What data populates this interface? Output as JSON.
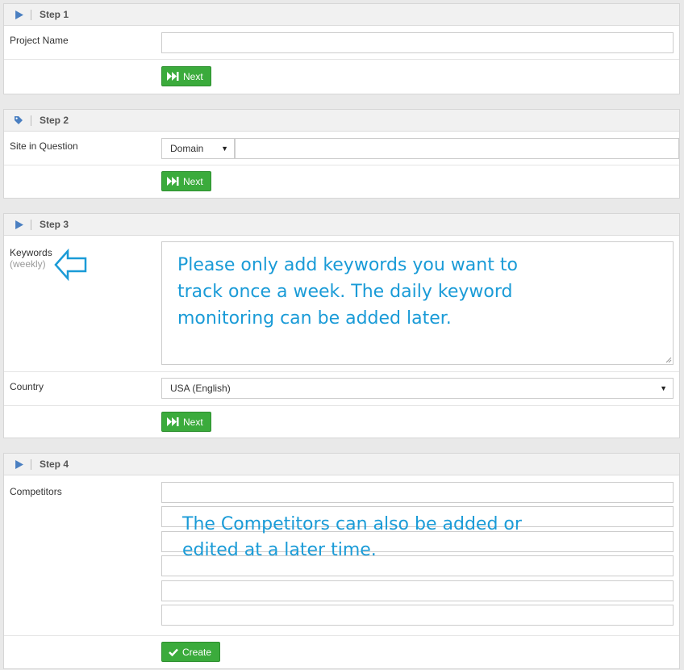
{
  "steps": [
    {
      "title": "Step 1",
      "icon": "play-icon"
    },
    {
      "title": "Step 2",
      "icon": "tag-icon"
    },
    {
      "title": "Step 3",
      "icon": "play-icon"
    },
    {
      "title": "Step 4",
      "icon": "play-icon"
    }
  ],
  "step1": {
    "project_name_label": "Project Name",
    "project_name_value": "",
    "next_label": "Next"
  },
  "step2": {
    "site_label": "Site in Question",
    "site_type": "Domain",
    "site_value": "",
    "next_label": "Next"
  },
  "step3": {
    "keywords_label": "Keywords",
    "keywords_sublabel": "(weekly)",
    "keywords_hint": "Please only add keywords you want to track once a week. The daily keyword monitoring can be added later.",
    "country_label": "Country",
    "country_value": "USA (English)",
    "next_label": "Next"
  },
  "step4": {
    "competitors_label": "Competitors",
    "competitors_hint": "The Competitors can also be added or edited at a later time.",
    "create_label": "Create"
  },
  "colors": {
    "accent_green": "#3bab3c",
    "hint_blue": "#1a9bd7",
    "icon_blue": "#4a7fc1"
  }
}
